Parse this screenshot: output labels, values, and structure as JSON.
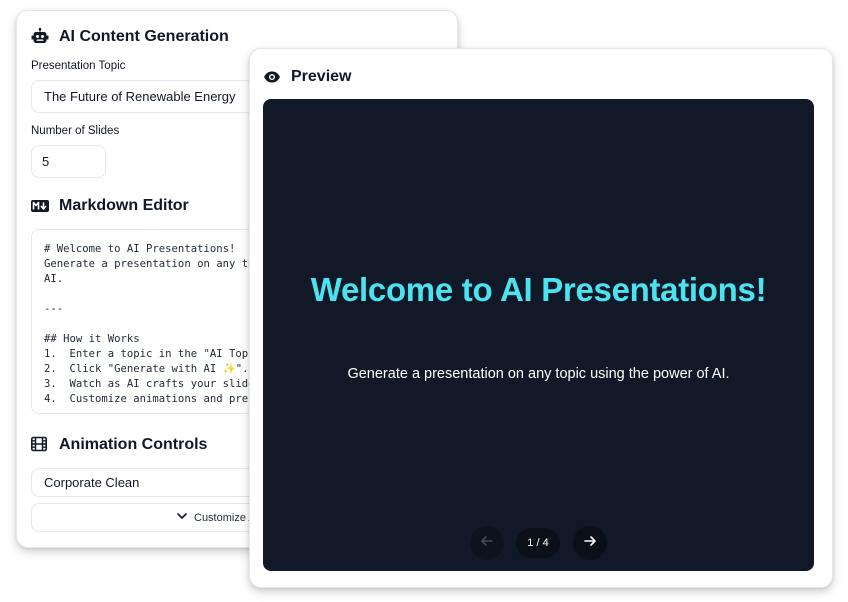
{
  "content_generation": {
    "title": "AI Content Generation",
    "icon": "robot-icon",
    "topic_label": "Presentation Topic",
    "topic_value": "The Future of Renewable Energy",
    "slides_label": "Number of Slides",
    "slides_value": "5"
  },
  "markdown_editor": {
    "title": "Markdown Editor",
    "icon": "markdown-icon",
    "content": "# Welcome to AI Presentations!\nGenerate a presentation on any to\nAI.\n\n---\n\n## How it Works\n1.  Enter a topic in the \"AI Topi\n2.  Click \"Generate with AI ✨\".\n3.  Watch as AI crafts your slide\n4.  Customize animations and pres"
  },
  "animation_controls": {
    "title": "Animation Controls",
    "icon": "film-icon",
    "theme_value": "Corporate Clean",
    "customize_label": "Customize A"
  },
  "preview": {
    "title": "Preview",
    "icon": "eye-icon",
    "slide_title": "Welcome to AI Presentations!",
    "slide_subtitle": "Generate a presentation on any topic using the power of AI.",
    "counter": "1 / 4",
    "prev_icon": "arrow-left-icon",
    "next_icon": "arrow-right-icon"
  },
  "colors": {
    "slide_background": "#111827",
    "slide_title": "#4be3f0",
    "text": "#111827"
  }
}
